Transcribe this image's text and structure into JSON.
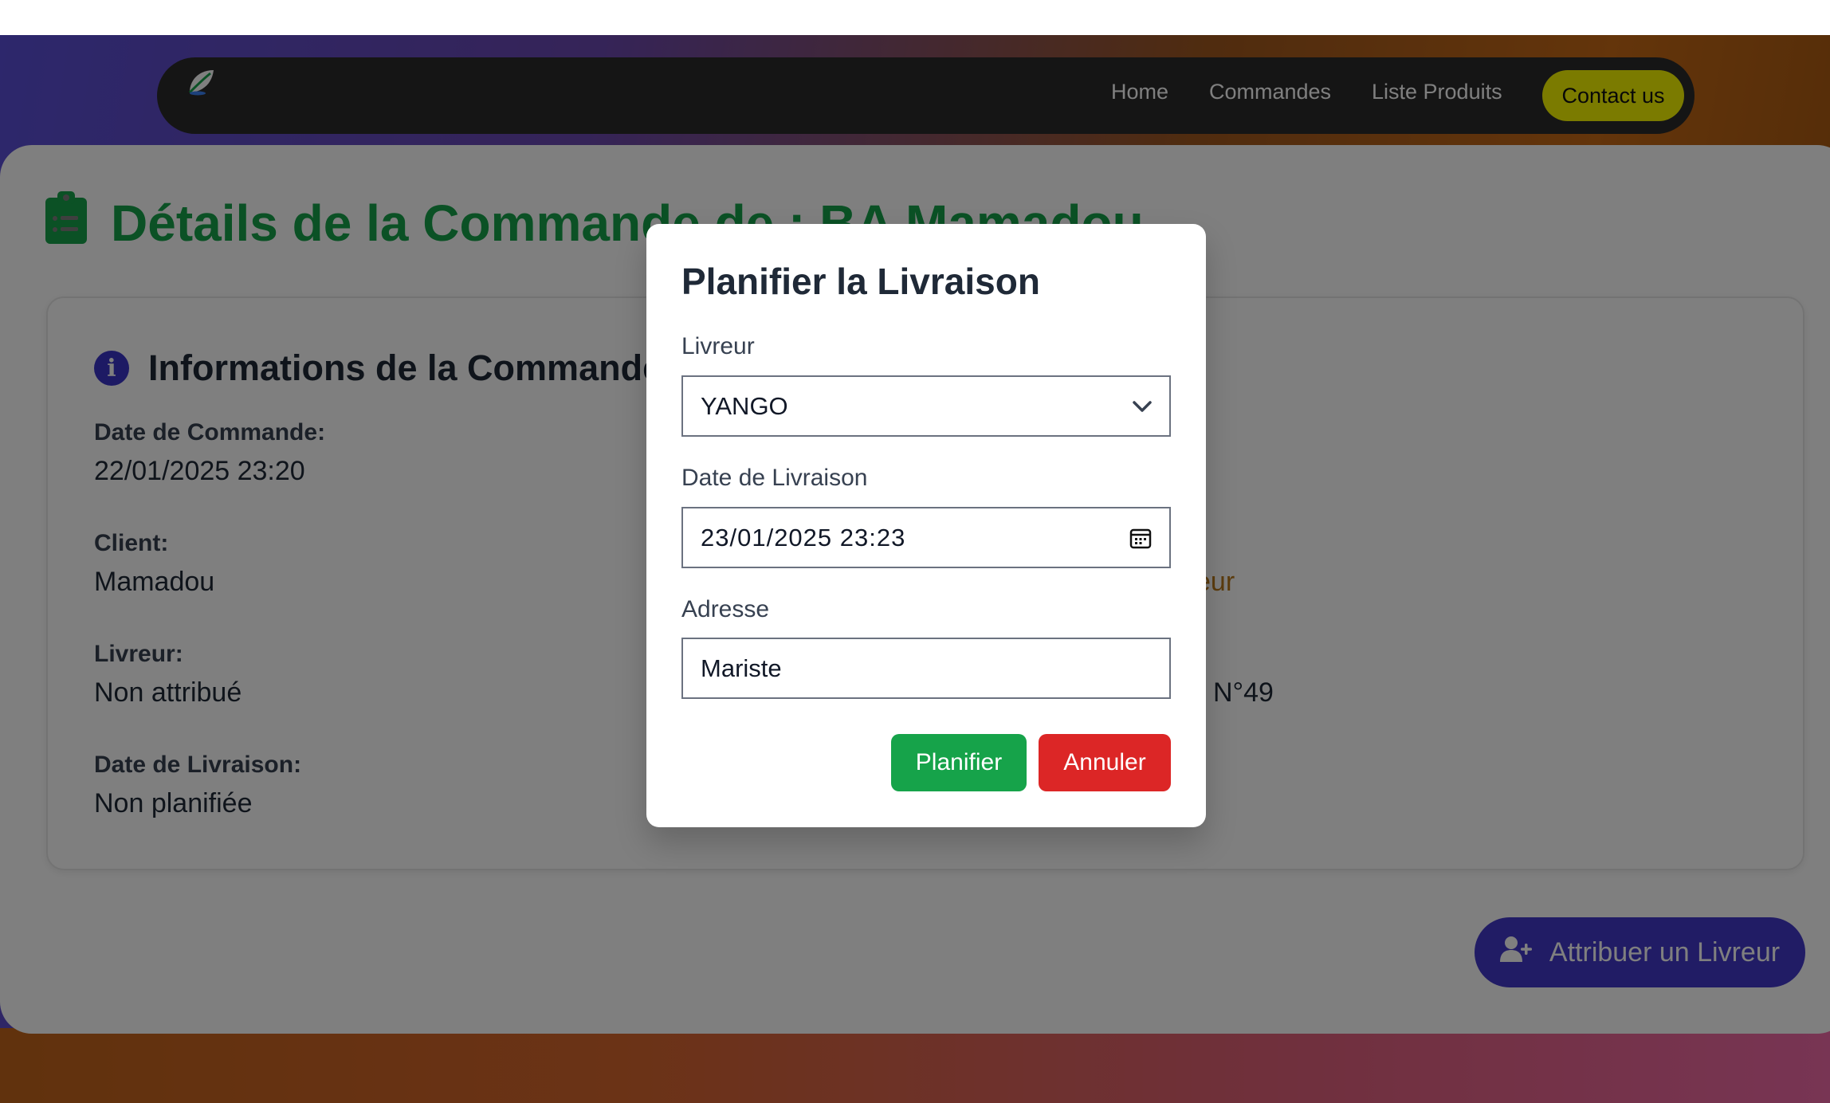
{
  "navbar": {
    "links": [
      "Home",
      "Commandes",
      "Liste Produits"
    ],
    "contact_label": "Contact us"
  },
  "page": {
    "title": "Détails de la Commande de : BA Mamadou"
  },
  "info": {
    "title": "Informations de la Commande",
    "fields": [
      {
        "label": "Date de Commande:",
        "value": "22/01/2025 23:20"
      },
      {
        "label": "Client:",
        "value": "Mamadou"
      },
      {
        "label": "Livreur:",
        "value": "Non attribué"
      },
      {
        "label": "Date de Livraison:",
        "value": "Non planifiée"
      }
    ],
    "partial_status_value": "eur",
    "partial_address_value": "N°49"
  },
  "assign_button": {
    "label": "Attribuer un Livreur"
  },
  "modal": {
    "title": "Planifier la Livraison",
    "livreur_label": "Livreur",
    "livreur_value": "YANGO",
    "date_label": "Date de Livraison",
    "date_value": "23/01/2025 23:23",
    "adresse_label": "Adresse",
    "adresse_value": "Mariste",
    "planifier_label": "Planifier",
    "annuler_label": "Annuler"
  },
  "colors": {
    "title_green": "#16a34a",
    "accent_indigo": "#4338ca",
    "danger_red": "#dc2626",
    "contact_yellow": "#f7f700",
    "navbar_dark": "#2b2b2b"
  },
  "icons": {
    "title_icon": "clipboard-list-icon",
    "info_icon": "info-circle-icon",
    "assign_icon": "user-plus-icon",
    "select_icon": "chevron-down-icon",
    "date_icon": "calendar-icon",
    "logo": "logo-leaf-icon"
  }
}
